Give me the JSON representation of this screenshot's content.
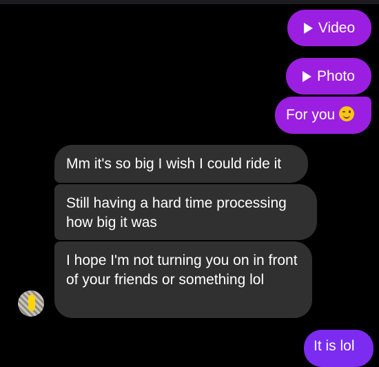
{
  "messages": {
    "video_label": "Video",
    "photo_label": "Photo",
    "for_you_text": "For you",
    "for_you_emoji": "winking-face",
    "incoming": [
      "Mm it's so big I wish I could ride it",
      "Still having a hard time processing how big it was",
      "I hope I'm not turning you on in front of your friends or something lol"
    ],
    "last_outgoing_partial": "It is lol"
  },
  "colors": {
    "outgoing": "#9b1fe0",
    "outgoing_last": "#7b2cf0",
    "incoming": "#303030",
    "background": "#000000"
  }
}
